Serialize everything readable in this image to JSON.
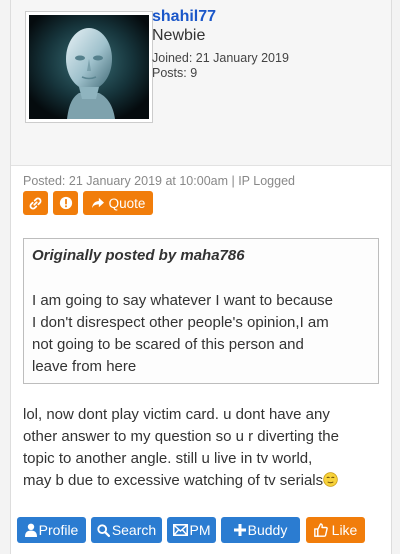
{
  "author": {
    "username": "shahil77",
    "rank": "Newbie",
    "joined": "Joined: 21 January 2019",
    "posts": "Posts: 9"
  },
  "post_meta": {
    "posted": "Posted: 21 January 2019 at 10:00am | IP Logged",
    "quote_label": "Quote"
  },
  "quote": {
    "header": "Originally posted by maha786",
    "lines": [
      "I am going to say whatever I want to because",
      "I don't disrespect other people's opinion,I am",
      "not going to be scared of this person and",
      "leave from here"
    ]
  },
  "message": {
    "lines": [
      "lol, now dont play victim card. u dont have any",
      "other answer to my question so u r diverting the",
      "topic to another angle. still u live in tv world,",
      "may b due to excessive watching of tv serials"
    ]
  },
  "actions": {
    "profile": "Profile",
    "search": "Search",
    "pm": "PM",
    "buddy": "Buddy",
    "like": "Like"
  },
  "colors": {
    "orange": "#f17d0b",
    "blue": "#2b7cd1",
    "username": "#1b57c9"
  },
  "icons": [
    "link-icon",
    "alert-icon",
    "share-arrow-icon",
    "user-icon",
    "search-icon",
    "mail-icon",
    "plus-icon",
    "thumbs-up-icon",
    "emoji-icon"
  ]
}
